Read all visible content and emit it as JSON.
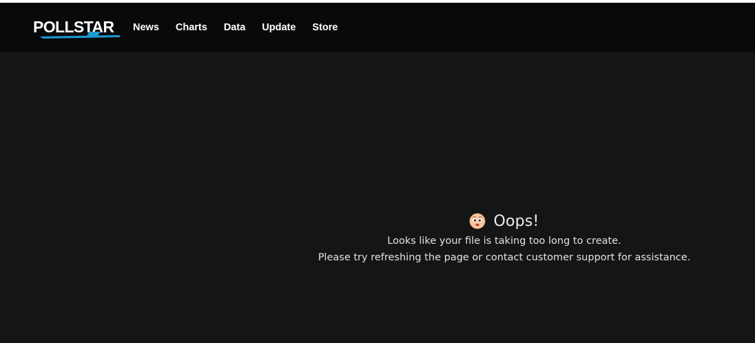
{
  "brand": {
    "logo_text": "POLLSTAR",
    "accent_color": "#1e9ad6",
    "nav_background": "#08090b",
    "page_background": "#141616"
  },
  "nav": {
    "items": [
      {
        "label": "News"
      },
      {
        "label": "Charts"
      },
      {
        "label": "Data"
      },
      {
        "label": "Update"
      },
      {
        "label": "Store"
      }
    ]
  },
  "error": {
    "icon": "worried-face-icon",
    "title": "Oops!",
    "line1": "Looks like your file is taking too long to create.",
    "line2": "Please try refreshing the page or contact customer support for assistance."
  }
}
